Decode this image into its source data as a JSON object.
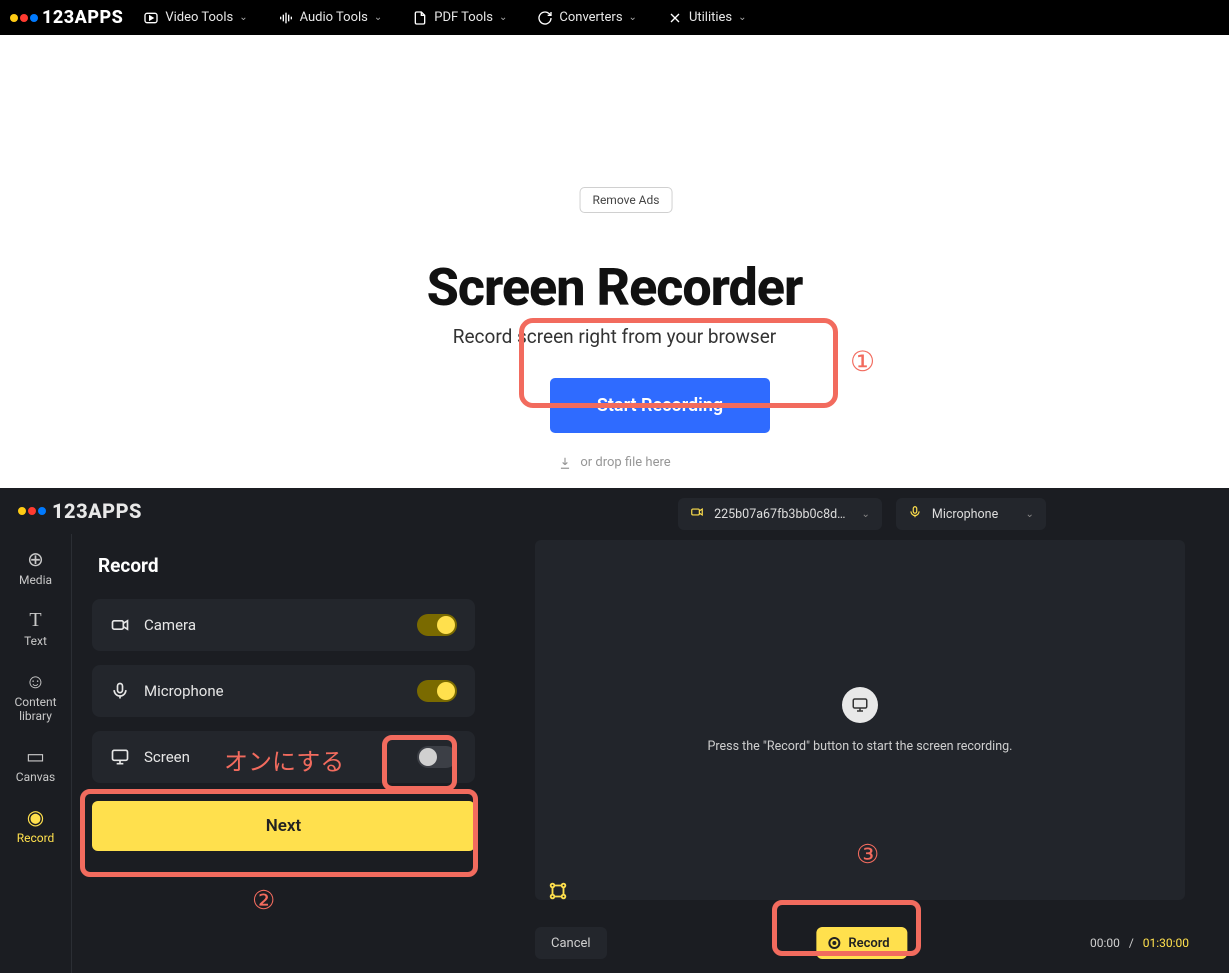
{
  "header": {
    "brand": "123APPS",
    "nav": [
      {
        "label": "Video Tools"
      },
      {
        "label": "Audio Tools"
      },
      {
        "label": "PDF Tools"
      },
      {
        "label": "Converters"
      },
      {
        "label": "Utilities"
      }
    ]
  },
  "landing": {
    "remove_ads": "Remove Ads",
    "title": "Screen Recorder",
    "subtitle": "Record screen right from your browser",
    "start_button": "Start Recording",
    "drop_hint": "or drop file here"
  },
  "annotations": {
    "one": "①",
    "two": "②",
    "three": "③",
    "jp_turn_on": "オンにする"
  },
  "left_panel": {
    "brand": "123APPS",
    "sidebar": [
      {
        "label": "Media"
      },
      {
        "label": "Text"
      },
      {
        "label": "Content library"
      },
      {
        "label": "Canvas"
      },
      {
        "label": "Record"
      }
    ],
    "section_title": "Record",
    "rows": {
      "camera": "Camera",
      "microphone": "Microphone",
      "screen": "Screen"
    },
    "next_button": "Next"
  },
  "right_panel": {
    "camera_dd": "225b07a67fb3bb0c8d…",
    "mic_dd": "Microphone",
    "canvas_message": "Press the \"Record\" button to start the screen recording.",
    "cancel": "Cancel",
    "record": "Record",
    "time_current": "00:00",
    "time_sep": "/",
    "time_total": "01:30:00"
  }
}
